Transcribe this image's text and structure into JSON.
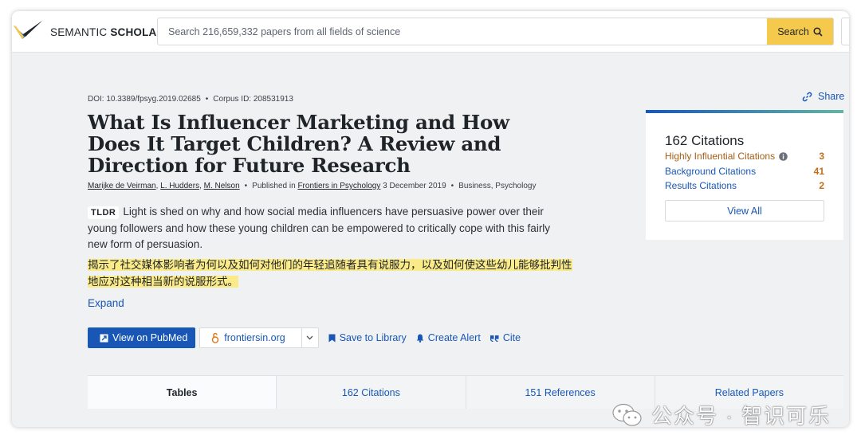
{
  "header": {
    "brand": {
      "light": "SEMANTIC",
      "bold": "SCHOLAR"
    },
    "search": {
      "placeholder": "Search 216,659,332 papers from all fields of science",
      "button_label": "Search",
      "icon": "search-icon"
    }
  },
  "paper": {
    "doi": "DOI: 10.3389/fpsyg.2019.02685",
    "corpus_id": "Corpus ID: 208531913",
    "title": "What Is Influencer Marketing and How Does It Target Children? A Review and Direction for Future Research",
    "authors": [
      "Marijke de Veirman",
      "L. Hudders",
      "M. Nelson"
    ],
    "published_prefix": "Published in",
    "venue": "Frontiers in Psychology",
    "date": "3 December 2019",
    "fields": "Business, Psychology",
    "tldr_badge": "TLDR",
    "tldr": "Light is shed on why and how social media influencers have persuasive power over their young followers and how these young children can be empowered to critically cope with this fairly new form of persuasion.",
    "translation": "揭示了社交媒体影响者为何以及如何对他们的年轻追随者具有说服力，以及如何使这些幼儿能够批判性地应对这种相当新的说服形式。",
    "expand_label": "Expand"
  },
  "actions": {
    "pubmed": "View on PubMed",
    "frontiers": "frontiersin.org",
    "save": "Save to Library",
    "alert": "Create Alert",
    "cite": "Cite"
  },
  "share": {
    "label": "Share"
  },
  "citations_card": {
    "title": "162 Citations",
    "rows": [
      {
        "label": "Highly Influential Citations",
        "count": "3"
      },
      {
        "label": "Background Citations",
        "count": "41"
      },
      {
        "label": "Results Citations",
        "count": "2"
      }
    ],
    "view_all": "View All"
  },
  "tabs": [
    {
      "label": "Tables"
    },
    {
      "label": "162 Citations"
    },
    {
      "label": "151 References"
    },
    {
      "label": "Related Papers"
    }
  ],
  "watermark": {
    "text": "公众号 · 智识可乐"
  },
  "colors": {
    "accent": "#1857b6",
    "search_button": "#f5c94c",
    "highlight": "#fbeb88",
    "citation_count": "#c16d1a"
  }
}
